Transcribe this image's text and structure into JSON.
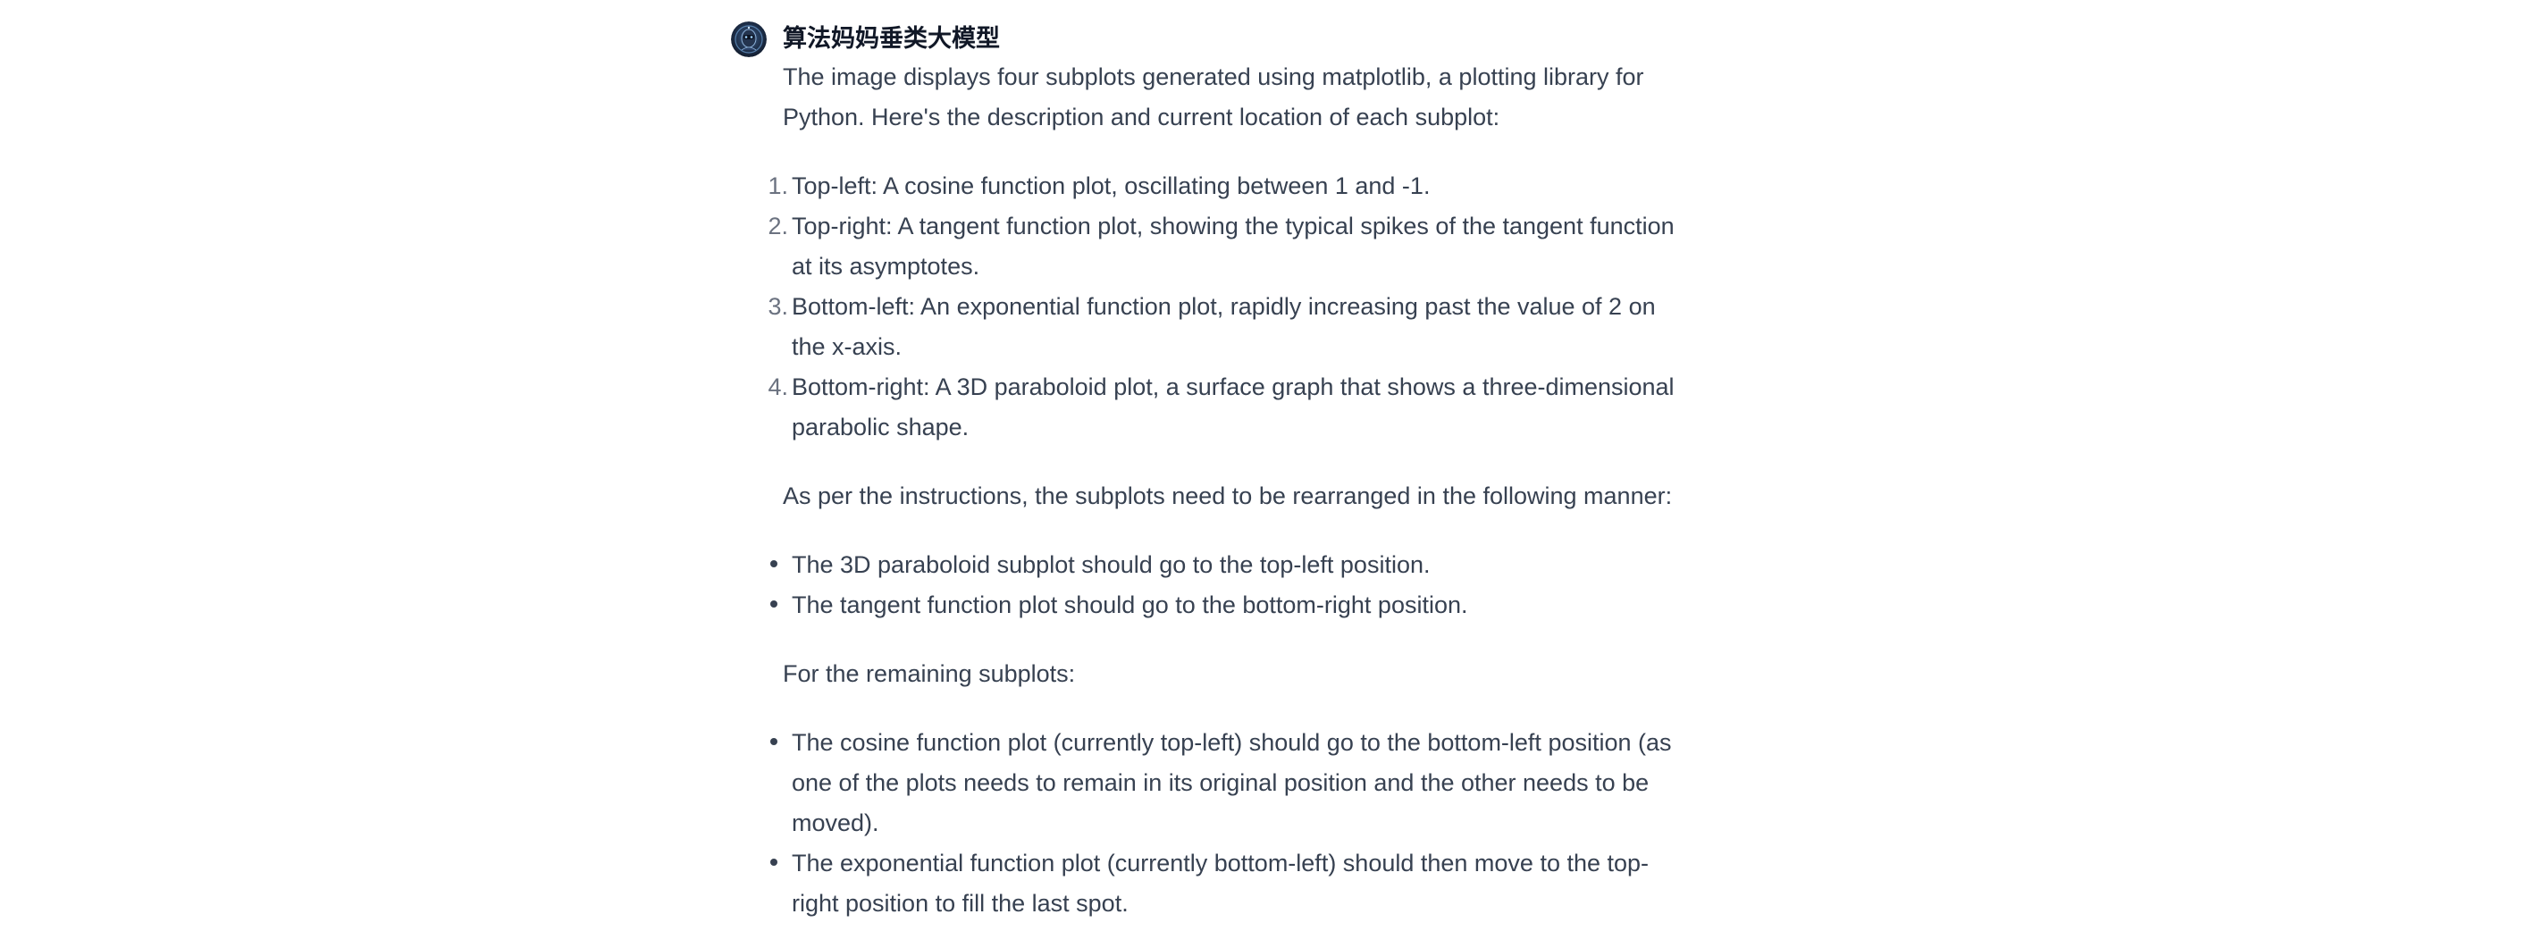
{
  "message": {
    "author": "算法妈妈垂类大模型",
    "avatar_icon": "robot-avatar-icon",
    "intro": "The image displays four subplots generated using matplotlib, a plotting library for Python. Here's the description and current location of each subplot:",
    "numbered_items": [
      {
        "num": "1.",
        "text": "Top-left: A cosine function plot, oscillating between 1 and -1."
      },
      {
        "num": "2.",
        "text": "Top-right: A tangent function plot, showing the typical spikes of the tangent function at its asymptotes."
      },
      {
        "num": "3.",
        "text": "Bottom-left: An exponential function plot, rapidly increasing past the value of 2 on the x-axis."
      },
      {
        "num": "4.",
        "text": "Bottom-right: A 3D paraboloid plot, a surface graph that shows a three-dimensional parabolic shape."
      }
    ],
    "instructions_intro": "As per the instructions, the subplots need to be rearranged in the following manner:",
    "instruction_bullets": [
      "The 3D paraboloid subplot should go to the top-left position.",
      "The tangent function plot should go to the bottom-right position."
    ],
    "remaining_intro": "For the remaining subplots:",
    "remaining_bullets": [
      "The cosine function plot (currently top-left) should go to the bottom-left position (as one of the plots needs to remain in its original position and the other needs to be moved).",
      "The exponential function plot (currently bottom-left) should then move to the top-right position to fill the last spot."
    ]
  },
  "colors": {
    "text": "#374151",
    "author": "#111827",
    "list_number": "#6b7280",
    "background": "#ffffff"
  }
}
